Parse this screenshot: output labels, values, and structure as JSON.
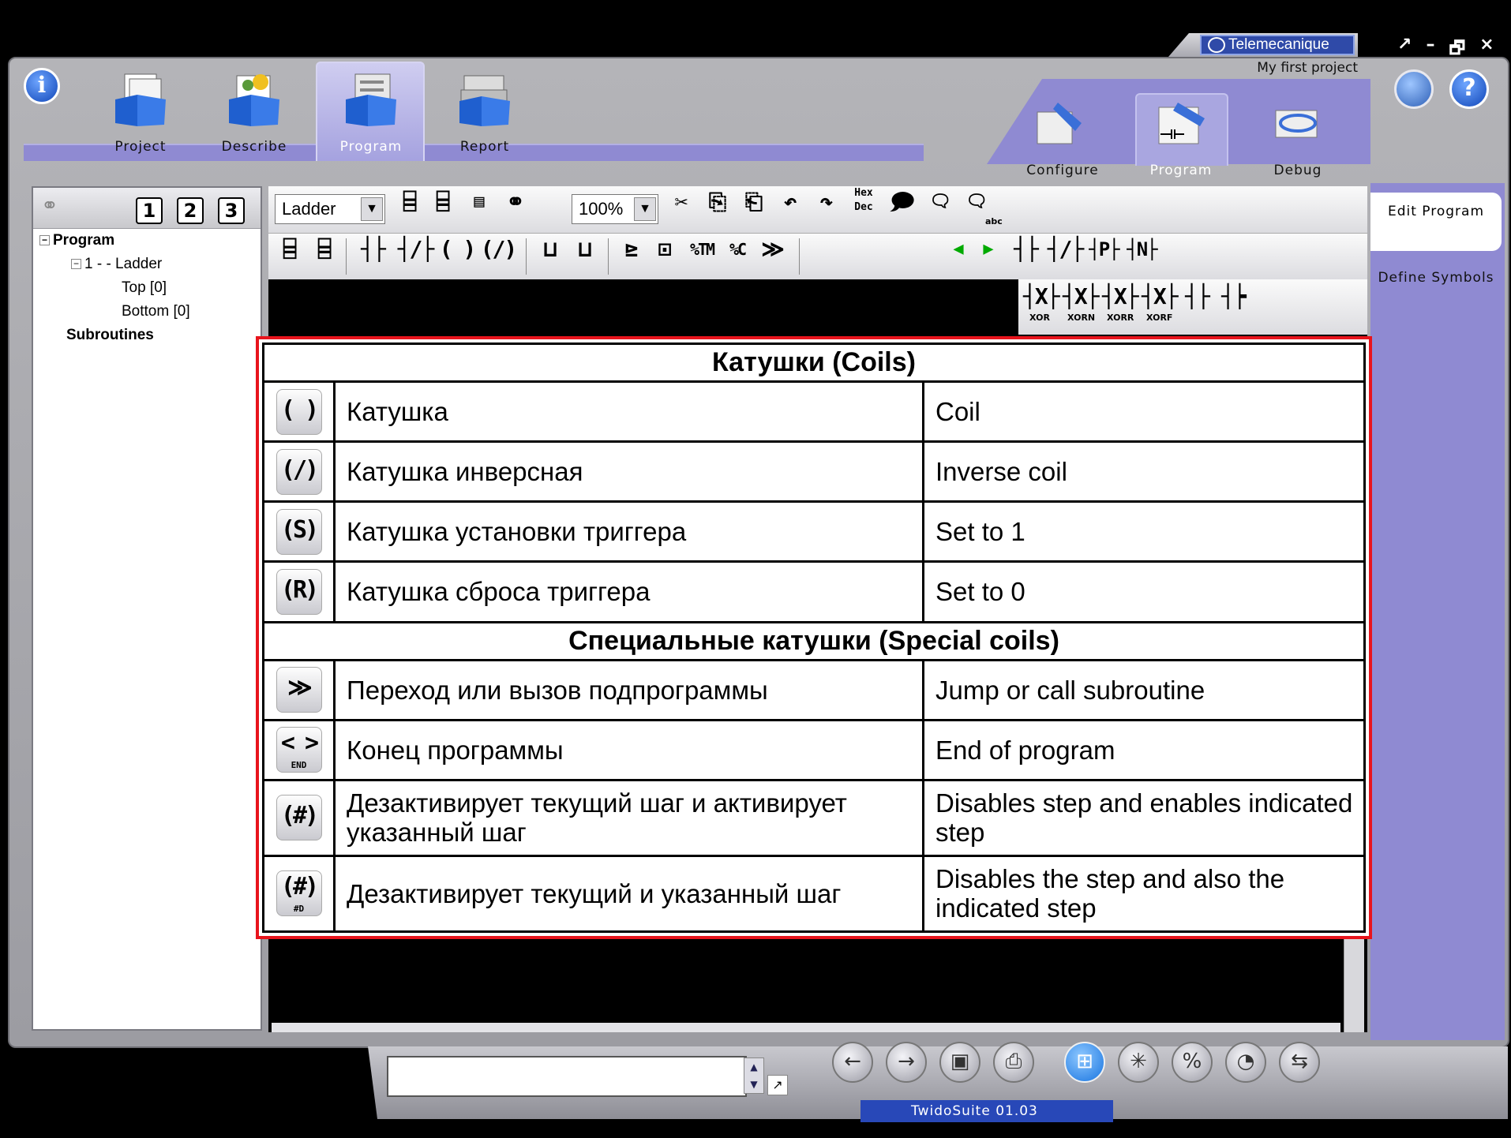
{
  "brand": {
    "name": "Telemecanique",
    "project": "My first project"
  },
  "window_controls": [
    "↗",
    "–",
    "🗗",
    "×"
  ],
  "modules": [
    {
      "label": "Project",
      "icon": "project-folder-icon"
    },
    {
      "label": "Describe",
      "icon": "describe-folder-icon"
    },
    {
      "label": "Program",
      "icon": "program-folder-icon",
      "active": true
    },
    {
      "label": "Report",
      "icon": "report-folder-icon"
    }
  ],
  "subtabs": [
    {
      "label": "Configure",
      "icon": "configure-icon"
    },
    {
      "label": "Program",
      "icon": "program-pen-icon",
      "active": true
    },
    {
      "label": "Debug",
      "icon": "debug-icon"
    }
  ],
  "left_panel": {
    "view_buttons": [
      "1",
      "2",
      "3"
    ],
    "tree": {
      "program": "Program",
      "section": "1 -  - Ladder",
      "top": "Top [0]",
      "bottom": "Bottom [0]",
      "subroutines": "Subroutines"
    }
  },
  "toolbar": {
    "language": "Ladder",
    "zoom": "100%",
    "hex": "Hex",
    "dec": "Dec",
    "contacts_row": [
      "┤├",
      "┤/├",
      "( )",
      "(/)"
    ],
    "blocks": [
      "%TM",
      "%C"
    ],
    "edge_contacts": [
      "┤P├",
      "┤N├"
    ],
    "xor_labels": [
      "XOR",
      "XORN",
      "XORR",
      "XORF"
    ],
    "abc": "abc"
  },
  "side_panel": {
    "edit_program": "Edit Program",
    "define_symbols": "Define Symbols"
  },
  "reference_table": {
    "sections": [
      {
        "title": "Катушки (Coils)",
        "rows": [
          {
            "symbol": "( )",
            "sub": "",
            "ru": "Катушка",
            "en": "Coil"
          },
          {
            "symbol": "(/)",
            "sub": "",
            "ru": "Катушка инверсная",
            "en": "Inverse coil"
          },
          {
            "symbol": "(S)",
            "sub": "",
            "ru": "Катушка установки триггера",
            "en": "Set to 1"
          },
          {
            "symbol": "(R)",
            "sub": "",
            "ru": "Катушка сброса триггера",
            "en": "Set to 0"
          }
        ]
      },
      {
        "title": "Специальные катушки (Special coils)",
        "rows": [
          {
            "symbol": "≫",
            "sub": "",
            "ru": "Переход или вызов подпрограммы",
            "en": "Jump or call subroutine"
          },
          {
            "symbol": "< >",
            "sub": "END",
            "ru": "Конец программы",
            "en": "End of program"
          },
          {
            "symbol": "(#)",
            "sub": "",
            "ru": "Дезактивирует текущий шаг и активирует указанный шаг",
            "en": "Disables step and enables indicated step"
          },
          {
            "symbol": "(#)",
            "sub": "#D",
            "ru": "Дезактивирует текущий и указанный шаг",
            "en": "Disables the step and also the indicated step"
          }
        ]
      }
    ]
  },
  "status": {
    "command_value": "",
    "version": "TwidoSuite 01.03"
  },
  "colors": {
    "accent_purple": "#8f8ad2",
    "highlight_red": "#e8141c",
    "brand_blue": "#2f4aa8"
  }
}
